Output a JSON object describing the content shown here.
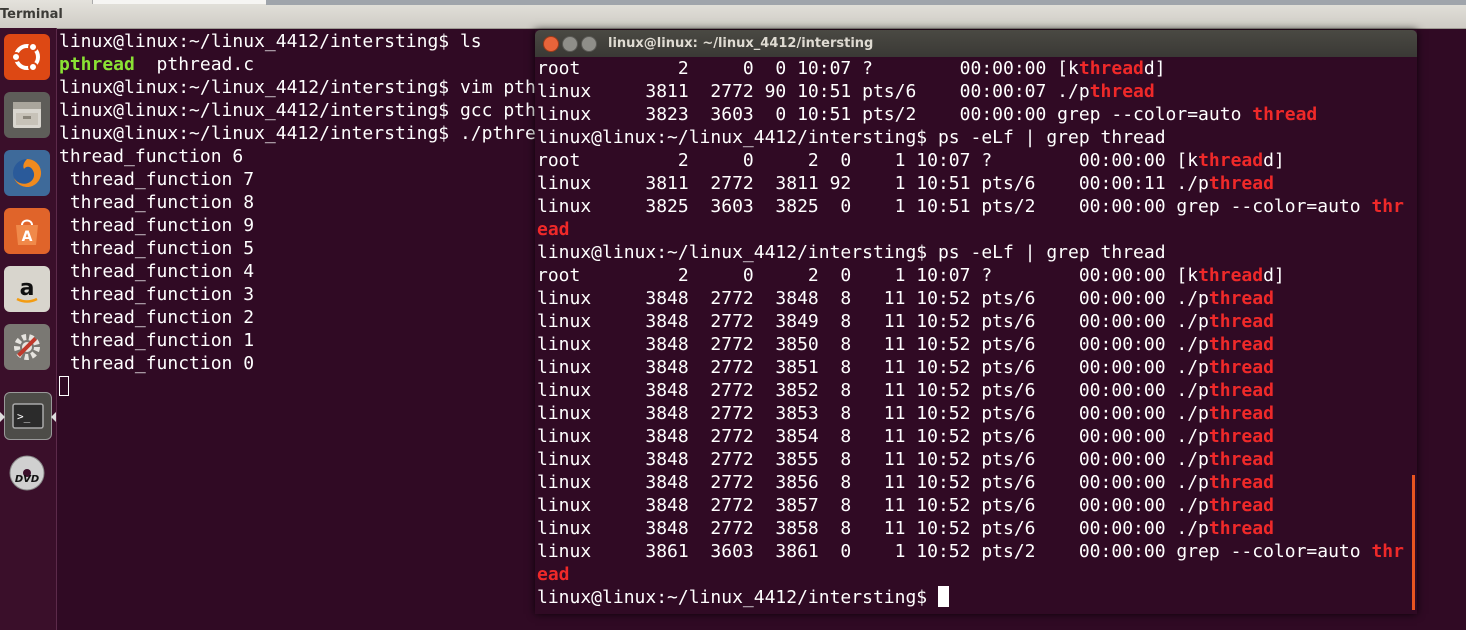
{
  "topbar": {
    "title": "Terminal"
  },
  "launcher": {
    "items": [
      {
        "icon": "ubuntu-dash-icon"
      },
      {
        "icon": "files-icon"
      },
      {
        "icon": "firefox-icon"
      },
      {
        "icon": "software-center-icon"
      },
      {
        "icon": "amazon-icon"
      },
      {
        "icon": "system-settings-icon"
      },
      {
        "icon": "terminal-icon"
      },
      {
        "icon": "dvd-icon"
      }
    ]
  },
  "colors": {
    "background": "#300a24",
    "accent_red": "#ef2929",
    "accent_green": "#8ae234",
    "scrollbar": "#e95420"
  },
  "bg_terminal": {
    "lines": [
      [
        {
          "t": "linux@linux:~/linux_4412/intersting$ ls"
        }
      ],
      [
        {
          "t": "pthread",
          "c": "green"
        },
        {
          "t": "  pthread.c"
        }
      ],
      [
        {
          "t": "linux@linux:~/linux_4412/intersting$ vim pth"
        }
      ],
      [
        {
          "t": "linux@linux:~/linux_4412/intersting$ gcc pth"
        }
      ],
      [
        {
          "t": "linux@linux:~/linux_4412/intersting$ ./pthre"
        }
      ],
      [
        {
          "t": "thread_function 6"
        }
      ],
      [
        {
          "t": " thread_function 7"
        }
      ],
      [
        {
          "t": " thread_function 8"
        }
      ],
      [
        {
          "t": " thread_function 9"
        }
      ],
      [
        {
          "t": " thread_function 5"
        }
      ],
      [
        {
          "t": " thread_function 4"
        }
      ],
      [
        {
          "t": " thread_function 3"
        }
      ],
      [
        {
          "t": " thread_function 2"
        }
      ],
      [
        {
          "t": " thread_function 1"
        }
      ],
      [
        {
          "t": " thread_function 0"
        }
      ]
    ]
  },
  "fg_terminal": {
    "title": "linux@linux: ~/linux_4412/intersting",
    "lines": [
      [
        {
          "t": "root         2     0  0 10:07 ?        00:00:00 [k"
        },
        {
          "t": "thread",
          "c": "red"
        },
        {
          "t": "d]"
        }
      ],
      [
        {
          "t": "linux     3811  2772 90 10:51 pts/6    00:00:07 ./p"
        },
        {
          "t": "thread",
          "c": "red"
        }
      ],
      [
        {
          "t": "linux     3823  3603  0 10:51 pts/2    00:00:00 grep --color=auto "
        },
        {
          "t": "thread",
          "c": "red"
        }
      ],
      [
        {
          "t": "linux@linux:~/linux_4412/intersting$ ps -eLf | grep thread"
        }
      ],
      [
        {
          "t": "root         2     0     2  0    1 10:07 ?        00:00:00 [k"
        },
        {
          "t": "thread",
          "c": "red"
        },
        {
          "t": "d]"
        }
      ],
      [
        {
          "t": "linux     3811  2772  3811 92    1 10:51 pts/6    00:00:11 ./p"
        },
        {
          "t": "thread",
          "c": "red"
        }
      ],
      [
        {
          "t": "linux     3825  3603  3825  0    1 10:51 pts/2    00:00:00 grep --color=auto "
        },
        {
          "t": "thr",
          "c": "red"
        }
      ],
      [
        {
          "t": "ead",
          "c": "red"
        }
      ],
      [
        {
          "t": "linux@linux:~/linux_4412/intersting$ ps -eLf | grep thread"
        }
      ],
      [
        {
          "t": "root         2     0     2  0    1 10:07 ?        00:00:00 [k"
        },
        {
          "t": "thread",
          "c": "red"
        },
        {
          "t": "d]"
        }
      ],
      [
        {
          "t": "linux     3848  2772  3848  8   11 10:52 pts/6    00:00:00 ./p"
        },
        {
          "t": "thread",
          "c": "red"
        }
      ],
      [
        {
          "t": "linux     3848  2772  3849  8   11 10:52 pts/6    00:00:00 ./p"
        },
        {
          "t": "thread",
          "c": "red"
        }
      ],
      [
        {
          "t": "linux     3848  2772  3850  8   11 10:52 pts/6    00:00:00 ./p"
        },
        {
          "t": "thread",
          "c": "red"
        }
      ],
      [
        {
          "t": "linux     3848  2772  3851  8   11 10:52 pts/6    00:00:00 ./p"
        },
        {
          "t": "thread",
          "c": "red"
        }
      ],
      [
        {
          "t": "linux     3848  2772  3852  8   11 10:52 pts/6    00:00:00 ./p"
        },
        {
          "t": "thread",
          "c": "red"
        }
      ],
      [
        {
          "t": "linux     3848  2772  3853  8   11 10:52 pts/6    00:00:00 ./p"
        },
        {
          "t": "thread",
          "c": "red"
        }
      ],
      [
        {
          "t": "linux     3848  2772  3854  8   11 10:52 pts/6    00:00:00 ./p"
        },
        {
          "t": "thread",
          "c": "red"
        }
      ],
      [
        {
          "t": "linux     3848  2772  3855  8   11 10:52 pts/6    00:00:00 ./p"
        },
        {
          "t": "thread",
          "c": "red"
        }
      ],
      [
        {
          "t": "linux     3848  2772  3856  8   11 10:52 pts/6    00:00:00 ./p"
        },
        {
          "t": "thread",
          "c": "red"
        }
      ],
      [
        {
          "t": "linux     3848  2772  3857  8   11 10:52 pts/6    00:00:00 ./p"
        },
        {
          "t": "thread",
          "c": "red"
        }
      ],
      [
        {
          "t": "linux     3848  2772  3858  8   11 10:52 pts/6    00:00:00 ./p"
        },
        {
          "t": "thread",
          "c": "red"
        }
      ],
      [
        {
          "t": "linux     3861  3603  3861  0    1 10:52 pts/2    00:00:00 grep --color=auto "
        },
        {
          "t": "thr",
          "c": "red"
        }
      ],
      [
        {
          "t": "ead",
          "c": "red"
        }
      ],
      [
        {
          "t": "linux@linux:~/linux_4412/intersting$ "
        }
      ]
    ]
  }
}
